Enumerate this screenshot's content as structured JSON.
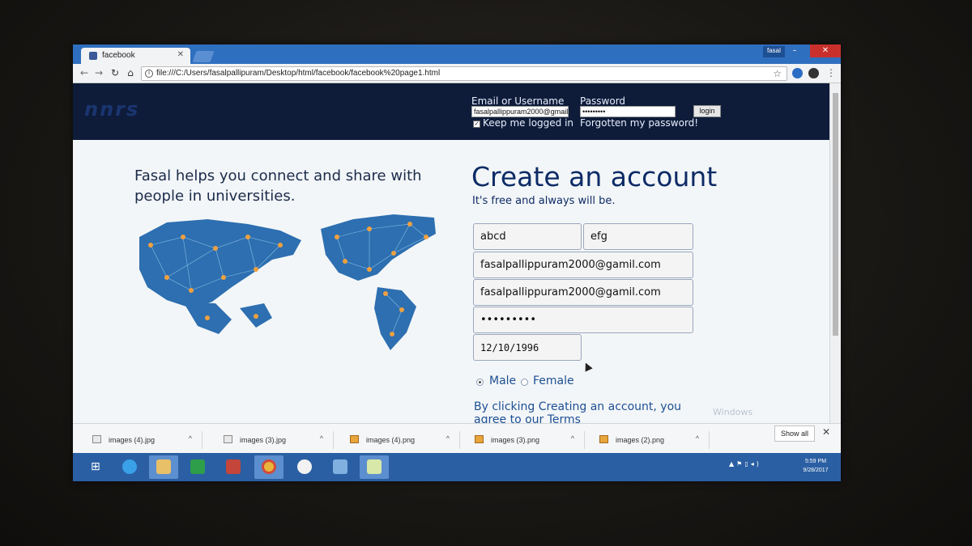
{
  "browser": {
    "tab_title": "facebook",
    "profile_name": "fasal",
    "url": "file:///C:/Users/fasalpallipuram/Desktop/html/facebook/facebook%20page1.html"
  },
  "header": {
    "logo_text": "nnrs",
    "email_label": "Email or Username",
    "email_value": "fasalpallippuram2000@gmail",
    "password_label": "Password",
    "password_value": "•••••••••",
    "login_label": "login",
    "keep_logged_in_label": "Keep me logged in",
    "keep_logged_in_checked": true,
    "forgot_label": "Forgotten my password!"
  },
  "intro": {
    "tagline": "Fasal helps you connect and share with people in universities."
  },
  "signup": {
    "title": "Create an account",
    "subtitle": "It's free and always will be.",
    "first_name": "abcd",
    "last_name": "efg",
    "email": "fasalpallippuram2000@gamil.com",
    "email_confirm": "fasalpallippuram2000@gamil.com",
    "password": "•••••••••",
    "birthday": "12/10/1996",
    "gender_male": "Male",
    "gender_female": "Female",
    "selected_gender": "Male",
    "terms": "By clicking Creating an account, you agree to our Terms"
  },
  "watermark": "Windows",
  "downloads": {
    "items": [
      "images (4).jpg",
      "images (3).jpg",
      "images (4).png",
      "images (3).png",
      "images (2).png"
    ],
    "show_all": "Show all"
  },
  "taskbar": {
    "time": "5:59 PM",
    "date": "9/28/2017"
  },
  "colors": {
    "header_bg": "#0e1c3a",
    "title_blue": "#0d2b66",
    "link_blue": "#1d4f93",
    "taskbar_bg": "#2a5fa3"
  }
}
